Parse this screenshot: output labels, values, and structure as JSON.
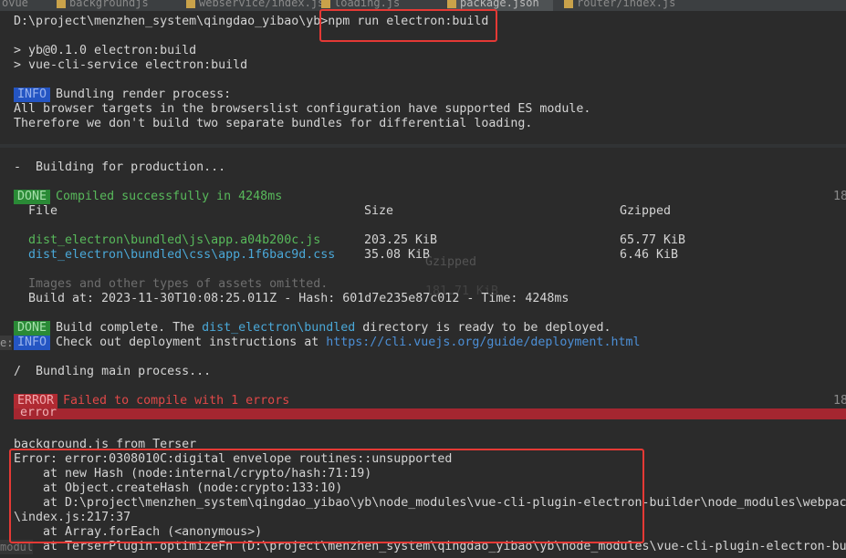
{
  "tabs": [
    "ovue",
    "backgroundjs",
    "webservice/index.js",
    "loading.js",
    "package.json",
    "router/index.js"
  ],
  "prompt": "D:\\project\\menzhen_system\\qingdao_yibao\\yb>",
  "command": "npm run electron:build",
  "script_lines": [
    "> yb@0.1.0 electron:build",
    "> vue-cli-service electron:build"
  ],
  "info1": {
    "label": "INFO",
    "text": "Bundling render process:"
  },
  "browsers_lines": [
    "All browser targets in the browserslist configuration have supported ES module.",
    "Therefore we don't build two separate bundles for differential loading."
  ],
  "building": "-  Building for production...",
  "done1": {
    "label": "DONE",
    "text": "Compiled successfully in 4248ms",
    "right": "18"
  },
  "table": {
    "headers": [
      "File",
      "Size",
      "Gzipped"
    ],
    "rows": [
      {
        "file": "dist_electron\\bundled\\js\\app.a04b200c.js",
        "size": "203.25 KiB",
        "gzip": "65.77 KiB"
      },
      {
        "file": "dist_electron\\bundled\\css\\app.1f6bac9d.css",
        "size": "35.08 KiB",
        "gzip": "6.46 KiB"
      }
    ],
    "ghost": [
      "Gzipped",
      "181.71 KiB"
    ]
  },
  "omitted": "Images and other types of assets omitted.",
  "build_at": "Build at: 2023-11-30T10:08:25.011Z - Hash: 601d7e235e87c012 - Time: 4248ms",
  "done2": {
    "label": "DONE",
    "pre": "Build complete. The ",
    "dir": "dist_electron\\bundled",
    "post": " directory is ready to be deployed."
  },
  "info2": {
    "gutter": "e:",
    "label": "INFO",
    "pre": "Check out deployment instructions at ",
    "url": "https://cli.vuejs.org/guide/deployment.html"
  },
  "bundling_main": "/  Bundling main process...",
  "error": {
    "label": "ERROR",
    "text": "Failed to compile with 1 errors",
    "right": "18",
    "sub": "error"
  },
  "terser": "background.js from Terser",
  "error_lines": [
    "Error: error:0308010C:digital envelope routines::unsupported",
    "    at new Hash (node:internal/crypto/hash:71:19)",
    "    at Object.createHash (node:crypto:133:10)",
    "    at D:\\project\\menzhen_system\\qingdao_yibao\\yb\\node_modules\\vue-cli-plugin-electron-builder\\node_modules\\webpac",
    "\\index.js:217:37",
    "    at Array.forEach (<anonymous>)",
    "    at TerserPlugin.optimizeFn (D:\\project\\menzhen_system\\qingdao_yibao\\yb\\node_modules\\vue-cli-plugin-electron-bu"
  ],
  "bottom_gutter": "modul",
  "colors": {
    "bg": "#2b2b2b",
    "highlight": "#e53935",
    "info": "#2455c3",
    "done": "#2a8a36",
    "error": "#b02a32"
  }
}
